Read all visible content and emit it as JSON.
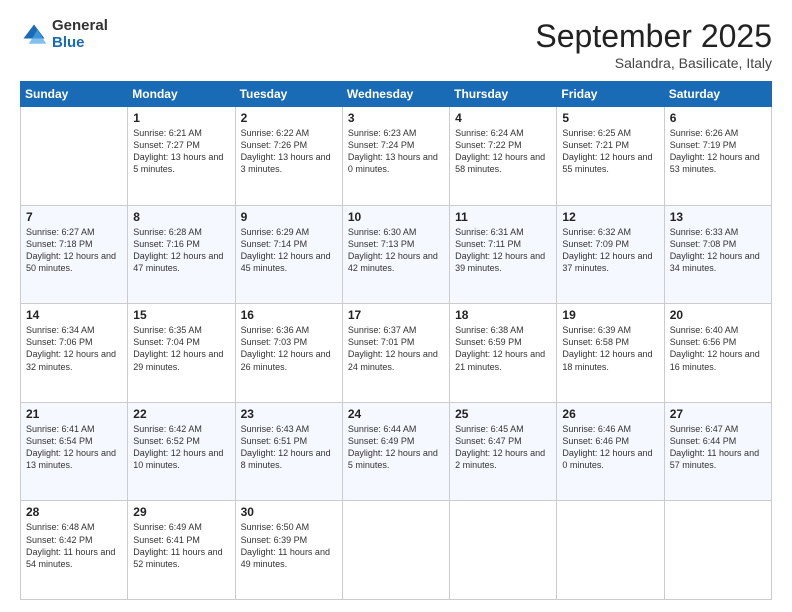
{
  "logo": {
    "general": "General",
    "blue": "Blue"
  },
  "header": {
    "month": "September 2025",
    "location": "Salandra, Basilicate, Italy"
  },
  "days": [
    "Sunday",
    "Monday",
    "Tuesday",
    "Wednesday",
    "Thursday",
    "Friday",
    "Saturday"
  ],
  "weeks": [
    [
      {
        "day": "",
        "sunrise": "",
        "sunset": "",
        "daylight": ""
      },
      {
        "day": "1",
        "sunrise": "Sunrise: 6:21 AM",
        "sunset": "Sunset: 7:27 PM",
        "daylight": "Daylight: 13 hours and 5 minutes."
      },
      {
        "day": "2",
        "sunrise": "Sunrise: 6:22 AM",
        "sunset": "Sunset: 7:26 PM",
        "daylight": "Daylight: 13 hours and 3 minutes."
      },
      {
        "day": "3",
        "sunrise": "Sunrise: 6:23 AM",
        "sunset": "Sunset: 7:24 PM",
        "daylight": "Daylight: 13 hours and 0 minutes."
      },
      {
        "day": "4",
        "sunrise": "Sunrise: 6:24 AM",
        "sunset": "Sunset: 7:22 PM",
        "daylight": "Daylight: 12 hours and 58 minutes."
      },
      {
        "day": "5",
        "sunrise": "Sunrise: 6:25 AM",
        "sunset": "Sunset: 7:21 PM",
        "daylight": "Daylight: 12 hours and 55 minutes."
      },
      {
        "day": "6",
        "sunrise": "Sunrise: 6:26 AM",
        "sunset": "Sunset: 7:19 PM",
        "daylight": "Daylight: 12 hours and 53 minutes."
      }
    ],
    [
      {
        "day": "7",
        "sunrise": "Sunrise: 6:27 AM",
        "sunset": "Sunset: 7:18 PM",
        "daylight": "Daylight: 12 hours and 50 minutes."
      },
      {
        "day": "8",
        "sunrise": "Sunrise: 6:28 AM",
        "sunset": "Sunset: 7:16 PM",
        "daylight": "Daylight: 12 hours and 47 minutes."
      },
      {
        "day": "9",
        "sunrise": "Sunrise: 6:29 AM",
        "sunset": "Sunset: 7:14 PM",
        "daylight": "Daylight: 12 hours and 45 minutes."
      },
      {
        "day": "10",
        "sunrise": "Sunrise: 6:30 AM",
        "sunset": "Sunset: 7:13 PM",
        "daylight": "Daylight: 12 hours and 42 minutes."
      },
      {
        "day": "11",
        "sunrise": "Sunrise: 6:31 AM",
        "sunset": "Sunset: 7:11 PM",
        "daylight": "Daylight: 12 hours and 39 minutes."
      },
      {
        "day": "12",
        "sunrise": "Sunrise: 6:32 AM",
        "sunset": "Sunset: 7:09 PM",
        "daylight": "Daylight: 12 hours and 37 minutes."
      },
      {
        "day": "13",
        "sunrise": "Sunrise: 6:33 AM",
        "sunset": "Sunset: 7:08 PM",
        "daylight": "Daylight: 12 hours and 34 minutes."
      }
    ],
    [
      {
        "day": "14",
        "sunrise": "Sunrise: 6:34 AM",
        "sunset": "Sunset: 7:06 PM",
        "daylight": "Daylight: 12 hours and 32 minutes."
      },
      {
        "day": "15",
        "sunrise": "Sunrise: 6:35 AM",
        "sunset": "Sunset: 7:04 PM",
        "daylight": "Daylight: 12 hours and 29 minutes."
      },
      {
        "day": "16",
        "sunrise": "Sunrise: 6:36 AM",
        "sunset": "Sunset: 7:03 PM",
        "daylight": "Daylight: 12 hours and 26 minutes."
      },
      {
        "day": "17",
        "sunrise": "Sunrise: 6:37 AM",
        "sunset": "Sunset: 7:01 PM",
        "daylight": "Daylight: 12 hours and 24 minutes."
      },
      {
        "day": "18",
        "sunrise": "Sunrise: 6:38 AM",
        "sunset": "Sunset: 6:59 PM",
        "daylight": "Daylight: 12 hours and 21 minutes."
      },
      {
        "day": "19",
        "sunrise": "Sunrise: 6:39 AM",
        "sunset": "Sunset: 6:58 PM",
        "daylight": "Daylight: 12 hours and 18 minutes."
      },
      {
        "day": "20",
        "sunrise": "Sunrise: 6:40 AM",
        "sunset": "Sunset: 6:56 PM",
        "daylight": "Daylight: 12 hours and 16 minutes."
      }
    ],
    [
      {
        "day": "21",
        "sunrise": "Sunrise: 6:41 AM",
        "sunset": "Sunset: 6:54 PM",
        "daylight": "Daylight: 12 hours and 13 minutes."
      },
      {
        "day": "22",
        "sunrise": "Sunrise: 6:42 AM",
        "sunset": "Sunset: 6:52 PM",
        "daylight": "Daylight: 12 hours and 10 minutes."
      },
      {
        "day": "23",
        "sunrise": "Sunrise: 6:43 AM",
        "sunset": "Sunset: 6:51 PM",
        "daylight": "Daylight: 12 hours and 8 minutes."
      },
      {
        "day": "24",
        "sunrise": "Sunrise: 6:44 AM",
        "sunset": "Sunset: 6:49 PM",
        "daylight": "Daylight: 12 hours and 5 minutes."
      },
      {
        "day": "25",
        "sunrise": "Sunrise: 6:45 AM",
        "sunset": "Sunset: 6:47 PM",
        "daylight": "Daylight: 12 hours and 2 minutes."
      },
      {
        "day": "26",
        "sunrise": "Sunrise: 6:46 AM",
        "sunset": "Sunset: 6:46 PM",
        "daylight": "Daylight: 12 hours and 0 minutes."
      },
      {
        "day": "27",
        "sunrise": "Sunrise: 6:47 AM",
        "sunset": "Sunset: 6:44 PM",
        "daylight": "Daylight: 11 hours and 57 minutes."
      }
    ],
    [
      {
        "day": "28",
        "sunrise": "Sunrise: 6:48 AM",
        "sunset": "Sunset: 6:42 PM",
        "daylight": "Daylight: 11 hours and 54 minutes."
      },
      {
        "day": "29",
        "sunrise": "Sunrise: 6:49 AM",
        "sunset": "Sunset: 6:41 PM",
        "daylight": "Daylight: 11 hours and 52 minutes."
      },
      {
        "day": "30",
        "sunrise": "Sunrise: 6:50 AM",
        "sunset": "Sunset: 6:39 PM",
        "daylight": "Daylight: 11 hours and 49 minutes."
      },
      {
        "day": "",
        "sunrise": "",
        "sunset": "",
        "daylight": ""
      },
      {
        "day": "",
        "sunrise": "",
        "sunset": "",
        "daylight": ""
      },
      {
        "day": "",
        "sunrise": "",
        "sunset": "",
        "daylight": ""
      },
      {
        "day": "",
        "sunrise": "",
        "sunset": "",
        "daylight": ""
      }
    ]
  ]
}
